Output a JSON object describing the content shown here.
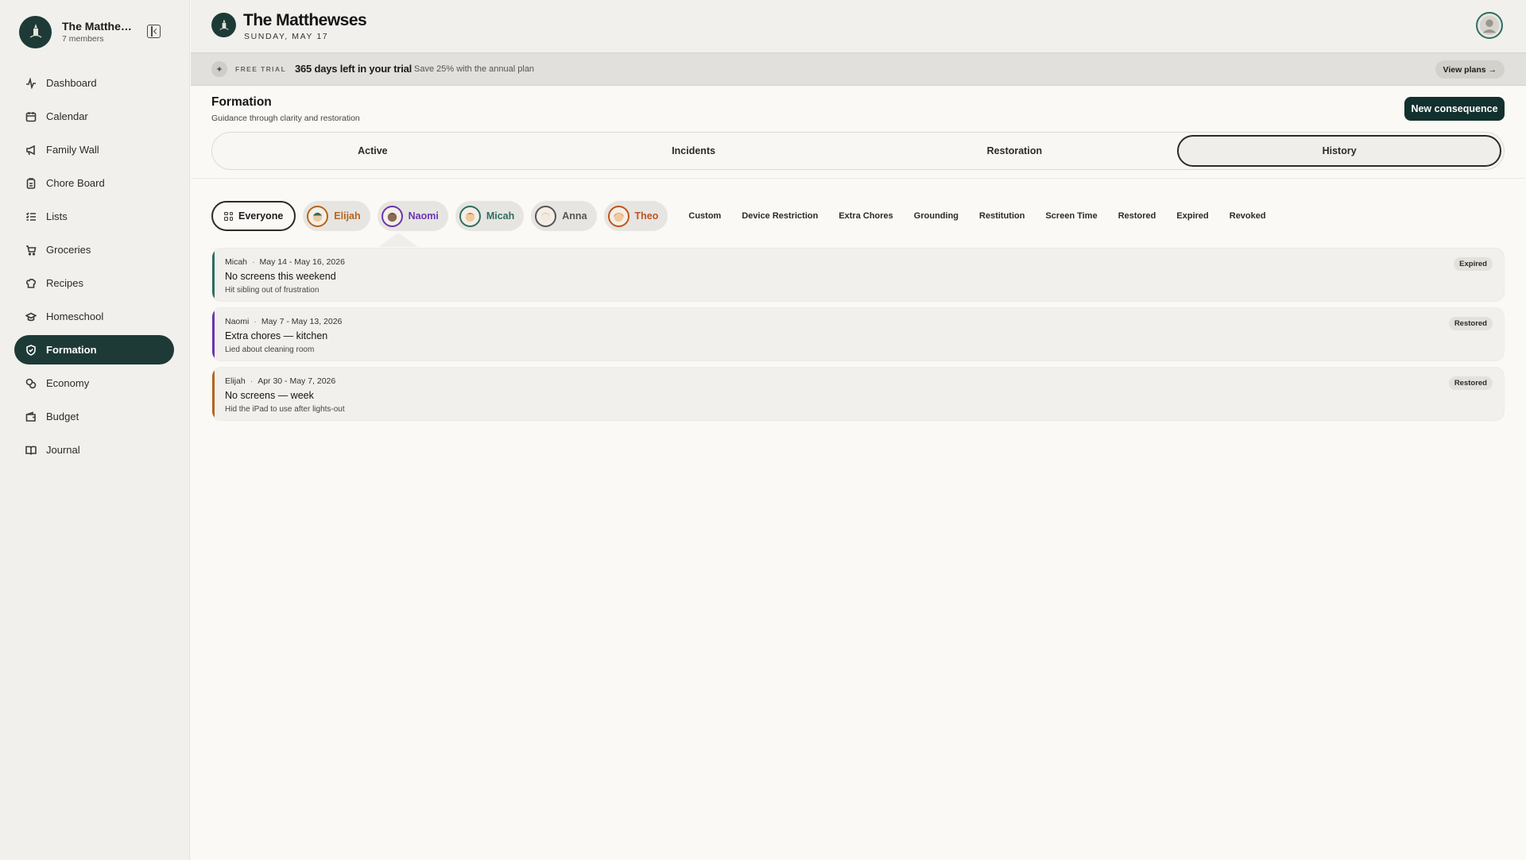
{
  "sidebar": {
    "family_name": "The Matthe…",
    "members": "7 members",
    "items": [
      {
        "label": "Dashboard",
        "icon": "activity-icon"
      },
      {
        "label": "Calendar",
        "icon": "calendar-icon"
      },
      {
        "label": "Family Wall",
        "icon": "megaphone-icon"
      },
      {
        "label": "Chore Board",
        "icon": "clipboard-icon"
      },
      {
        "label": "Lists",
        "icon": "list-icon"
      },
      {
        "label": "Groceries",
        "icon": "cart-icon"
      },
      {
        "label": "Recipes",
        "icon": "chef-hat-icon"
      },
      {
        "label": "Homeschool",
        "icon": "graduation-cap-icon"
      },
      {
        "label": "Formation",
        "icon": "shield-icon",
        "active": true
      },
      {
        "label": "Economy",
        "icon": "coins-icon"
      },
      {
        "label": "Budget",
        "icon": "wallet-icon"
      },
      {
        "label": "Journal",
        "icon": "book-icon"
      }
    ]
  },
  "header": {
    "title": "The Matthewses",
    "date": "SUNDAY, MAY 17"
  },
  "trial": {
    "label": "FREE TRIAL",
    "days": "365 days left in your trial",
    "save": "Save 25% with the annual plan",
    "button": "View plans →"
  },
  "page": {
    "title": "Formation",
    "subtitle": "Guidance through clarity and restoration",
    "new_button": "New consequence"
  },
  "tabs": [
    {
      "label": "Active"
    },
    {
      "label": "Incidents"
    },
    {
      "label": "Restoration"
    },
    {
      "label": "History",
      "active": true
    }
  ],
  "filters": {
    "everyone": "Everyone",
    "people": [
      {
        "name": "Elijah",
        "color": "#b5651d"
      },
      {
        "name": "Naomi",
        "color": "#6a35b0"
      },
      {
        "name": "Micah",
        "color": "#2d6e62"
      },
      {
        "name": "Anna",
        "color": "#555555"
      },
      {
        "name": "Theo",
        "color": "#c0541e"
      }
    ],
    "types": [
      "Custom",
      "Device Restriction",
      "Extra Chores",
      "Grounding",
      "Restitution",
      "Screen Time",
      "Restored",
      "Expired",
      "Revoked"
    ]
  },
  "history": [
    {
      "person": "Micah",
      "dates": "May 14 - May 16, 2026",
      "title": "No screens this weekend",
      "reason": "Hit sibling out of frustration",
      "status": "Expired",
      "color": "#2d6e62"
    },
    {
      "person": "Naomi",
      "dates": "May 7 - May 13, 2026",
      "title": "Extra chores — kitchen",
      "reason": "Lied about cleaning room",
      "status": "Restored",
      "color": "#6a35b0"
    },
    {
      "person": "Elijah",
      "dates": "Apr 30 - May 7, 2026",
      "title": "No screens — week",
      "reason": "Hid the iPad to use after lights-out",
      "status": "Restored",
      "color": "#b5651d"
    }
  ]
}
